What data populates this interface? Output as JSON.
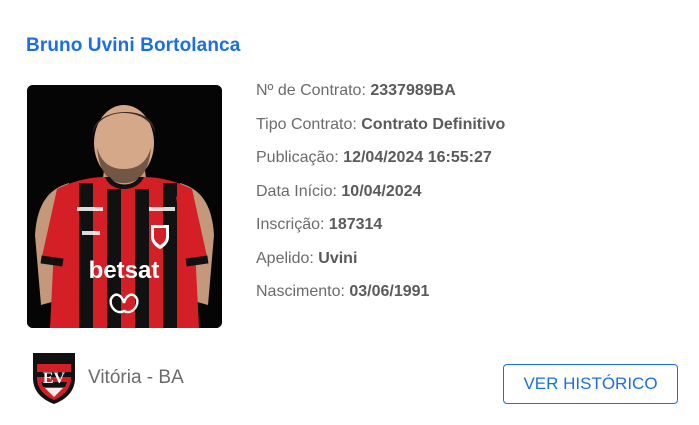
{
  "player": {
    "name": "Bruno Uvini Bortolanca",
    "photo_alt": "Bruno Uvini Bortolanca",
    "shirt_sponsor": "betsat",
    "details": [
      {
        "label": "Nº de Contrato:",
        "value": "2337989BA"
      },
      {
        "label": "Tipo Contrato:",
        "value": "Contrato Definitivo"
      },
      {
        "label": "Publicação:",
        "value": "12/04/2024 16:55:27"
      },
      {
        "label": "Data Início:",
        "value": "10/04/2024"
      },
      {
        "label": "Inscrição:",
        "value": "187314"
      },
      {
        "label": "Apelido:",
        "value": "Uvini"
      },
      {
        "label": "Nascimento:",
        "value": "03/06/1991"
      }
    ]
  },
  "club": {
    "name": "Vitória - BA",
    "crest_icon": "club-crest-icon"
  },
  "actions": {
    "history_label": "VER HISTÓRICO"
  },
  "colors": {
    "accent": "#1a6fe8",
    "text": "#6b6b6b",
    "club_red": "#d41f26",
    "club_black": "#111111"
  }
}
